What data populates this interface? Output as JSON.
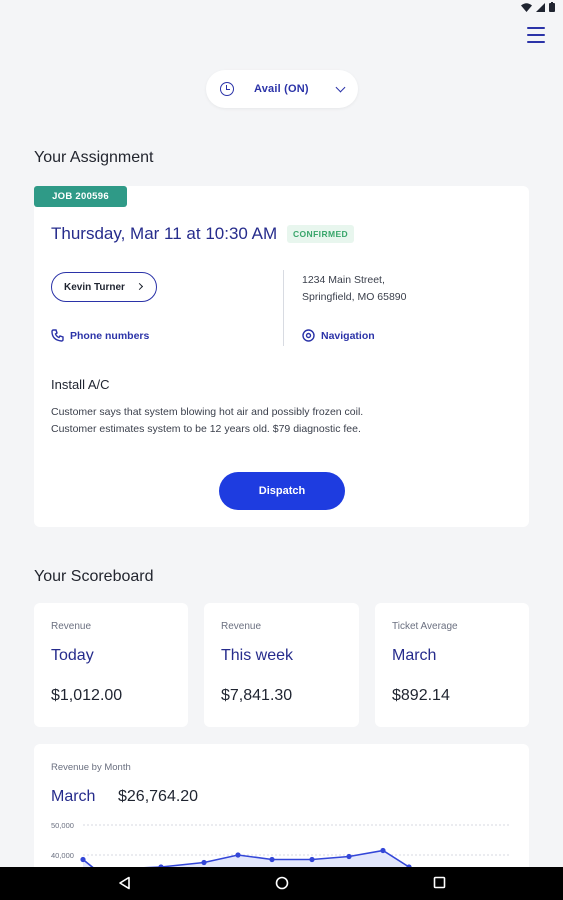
{
  "status": {
    "label": "Avail (ON)"
  },
  "assignment": {
    "section_title": "Your Assignment",
    "job_tag": "JOB 200596",
    "date": "Thursday, Mar 11 at 10:30 AM",
    "status_badge": "CONFIRMED",
    "customer_name": "Kevin Turner",
    "address_line1": "1234 Main Street,",
    "address_line2": "Springfield, MO 65890",
    "phone_link": "Phone numbers",
    "navigation_link": "Navigation",
    "job_title": "Install A/C",
    "description_line1": "Customer says that system blowing hot air and possibly frozen coil.",
    "description_line2": "Customer estimates system to be 12 years old. $79 diagnostic fee.",
    "dispatch_label": "Dispatch"
  },
  "scoreboard": {
    "section_title": "Your Scoreboard",
    "cards": [
      {
        "label": "Revenue",
        "period": "Today",
        "amount": "$1,012.00"
      },
      {
        "label": "Revenue",
        "period": "This week",
        "amount": "$7,841.30"
      },
      {
        "label": "Ticket Average",
        "period": "March",
        "amount": "$892.14"
      }
    ]
  },
  "revenue_chart": {
    "label": "Revenue by Month",
    "month": "March",
    "total": "$26,764.20"
  },
  "colors": {
    "accent": "#2b33a8",
    "primary_button": "#1e3ce0",
    "tag": "#2f9a87",
    "confirmed_text": "#39a66b",
    "line": "#3346d8"
  },
  "chart_data": {
    "type": "area",
    "ylim": [
      30000,
      50000
    ],
    "y_ticks": [
      "50,000",
      "40,000"
    ],
    "y_tick_values": [
      50000,
      40000
    ],
    "series": [
      {
        "values": [
          38500,
          35000,
          36000,
          37500,
          40000,
          38500,
          38500,
          39500,
          41500,
          36000
        ]
      }
    ],
    "grid": true
  }
}
